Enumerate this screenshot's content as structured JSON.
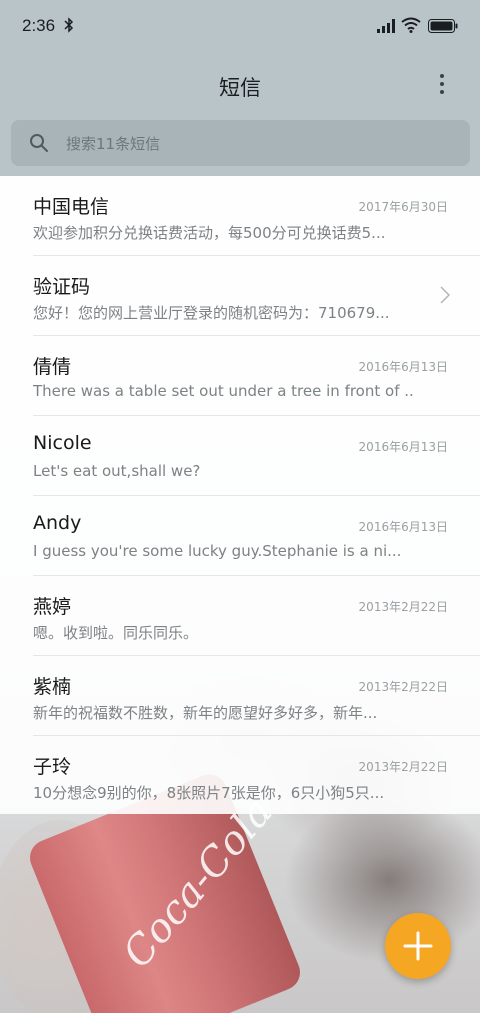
{
  "status_bar": {
    "time": "2:36",
    "icons": [
      "bluetooth-icon",
      "signal-icon",
      "wifi-icon",
      "battery-icon"
    ]
  },
  "header": {
    "title": "短信",
    "menu_icon": "more-vertical-icon"
  },
  "search": {
    "placeholder": "搜索11条短信",
    "icon": "search-icon"
  },
  "conversations": [
    {
      "sender": "中国电信",
      "date": "2017年6月30日",
      "preview": "欢迎参加积分兑换话费活动，每500分可兑换话费5..."
    },
    {
      "sender": "验证码",
      "date": "",
      "preview": "您好！您的网上营业厅登录的随机密码为：710679...",
      "has_chevron": true
    },
    {
      "sender": "倩倩",
      "date": "2016年6月13日",
      "preview": "There was a table set out under a tree in front of ..."
    },
    {
      "sender": "Nicole",
      "date": "2016年6月13日",
      "preview": "Let's eat out,shall we?"
    },
    {
      "sender": "Andy",
      "date": "2016年6月13日",
      "preview": "I guess you're some lucky guy.Stephanie is a ni..."
    },
    {
      "sender": "燕婷",
      "date": "2013年2月22日",
      "preview": "嗯。收到啦。同乐同乐。"
    },
    {
      "sender": "紫楠",
      "date": "2013年2月22日",
      "preview": "新年的祝福数不胜数，新年的愿望好多好多，新年..."
    },
    {
      "sender": "子玲",
      "date": "2013年2月22日",
      "preview": "10分想念9别的你，8张照片7张是你，6只小狗5只..."
    }
  ],
  "fab": {
    "icon": "plus-icon"
  },
  "background": {
    "can_text": "Coca-Cola"
  },
  "colors": {
    "header_bg": "#b9c4c9",
    "search_bg": "#a9b4b9",
    "fab": "#f5a623"
  }
}
